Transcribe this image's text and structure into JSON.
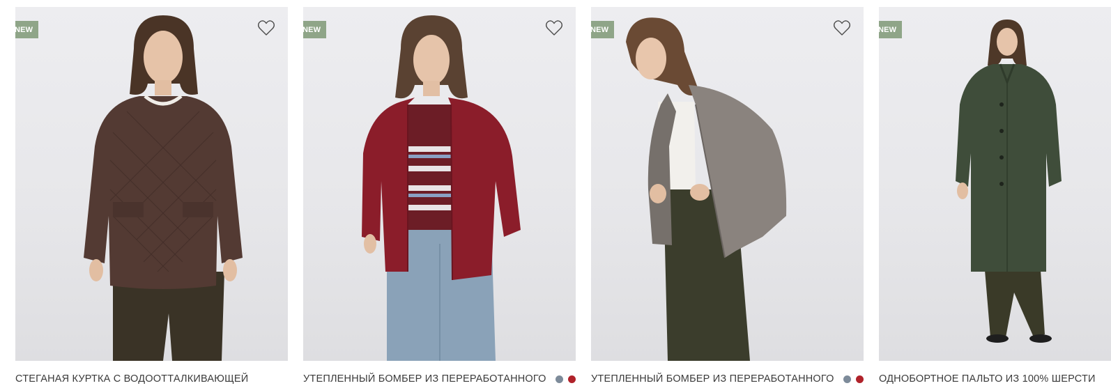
{
  "products": [
    {
      "badge": "NEW",
      "title": "СТЕГАНАЯ КУРТКА С ВОДООТТАЛКИВАЮЩЕЙ",
      "swatches": []
    },
    {
      "badge": "NEW",
      "title": "УТЕПЛЕННЫЙ БОМБЕР ИЗ ПЕРЕРАБОТАННОГО",
      "swatches": [
        "#7d8b9a",
        "#b0222a"
      ]
    },
    {
      "badge": "NEW",
      "title": "УТЕПЛЕННЫЙ БОМБЕР ИЗ ПЕРЕРАБОТАННОГО",
      "swatches": [
        "#7d8b9a",
        "#b0222a"
      ]
    },
    {
      "badge": "NEW",
      "title": "ОДНОБОРТНОЕ ПАЛЬТО ИЗ 100% ШЕРСТИ",
      "swatches": []
    }
  ],
  "icons": {
    "favorite": "heart-outline-icon"
  },
  "colors": {
    "badge_bg": "#8fa588",
    "title_text": "#3a3a3a"
  }
}
